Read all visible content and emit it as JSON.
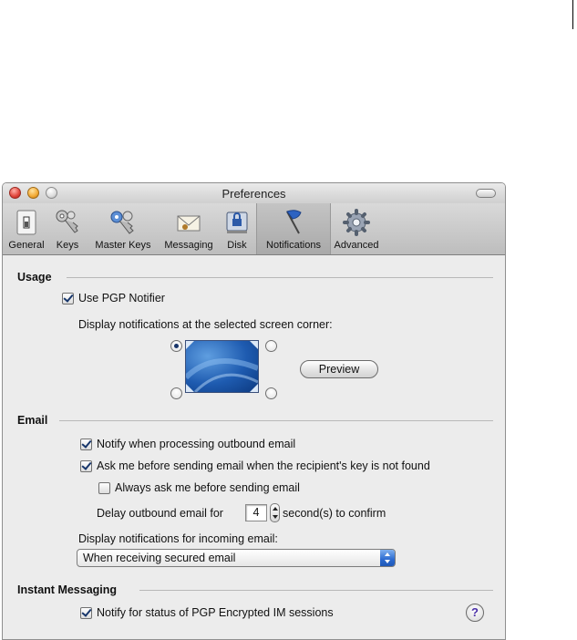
{
  "window": {
    "title": "Preferences"
  },
  "toolbar": {
    "items": [
      {
        "label": "General",
        "icon": "switch-icon"
      },
      {
        "label": "Keys",
        "icon": "keys-icon"
      },
      {
        "label": "Master Keys",
        "icon": "master-keys-icon"
      },
      {
        "label": "Messaging",
        "icon": "envelope-icon"
      },
      {
        "label": "Disk",
        "icon": "disk-lock-icon"
      },
      {
        "label": "Notifications",
        "icon": "flag-icon",
        "selected": true
      },
      {
        "label": "Advanced",
        "icon": "gear-icon"
      }
    ]
  },
  "usage": {
    "title": "Usage",
    "use_notifier": {
      "label": "Use PGP Notifier",
      "checked": true
    },
    "corner_prompt": "Display notifications at the selected screen corner:",
    "selected_corner": "top-left",
    "preview_label": "Preview"
  },
  "email": {
    "title": "Email",
    "notify_outbound": {
      "label": "Notify when processing outbound email",
      "checked": true
    },
    "ask_key_not_found": {
      "label": "Ask me before sending email when the recipient's key is not found",
      "checked": true
    },
    "always_ask": {
      "label": "Always ask me before sending email",
      "checked": false
    },
    "delay_prefix": "Delay outbound email for",
    "delay_value": "4",
    "delay_suffix": "second(s) to confirm",
    "incoming_prompt": "Display notifications for incoming email:",
    "incoming_selected": "When receiving secured email"
  },
  "im": {
    "title": "Instant Messaging",
    "notify_im": {
      "label": "Notify for status of PGP Encrypted IM sessions",
      "checked": true
    },
    "help_label": "?"
  },
  "colors": {
    "accent": "#2b6ad0",
    "check": "#17366b",
    "help": "#4b2fa8"
  }
}
